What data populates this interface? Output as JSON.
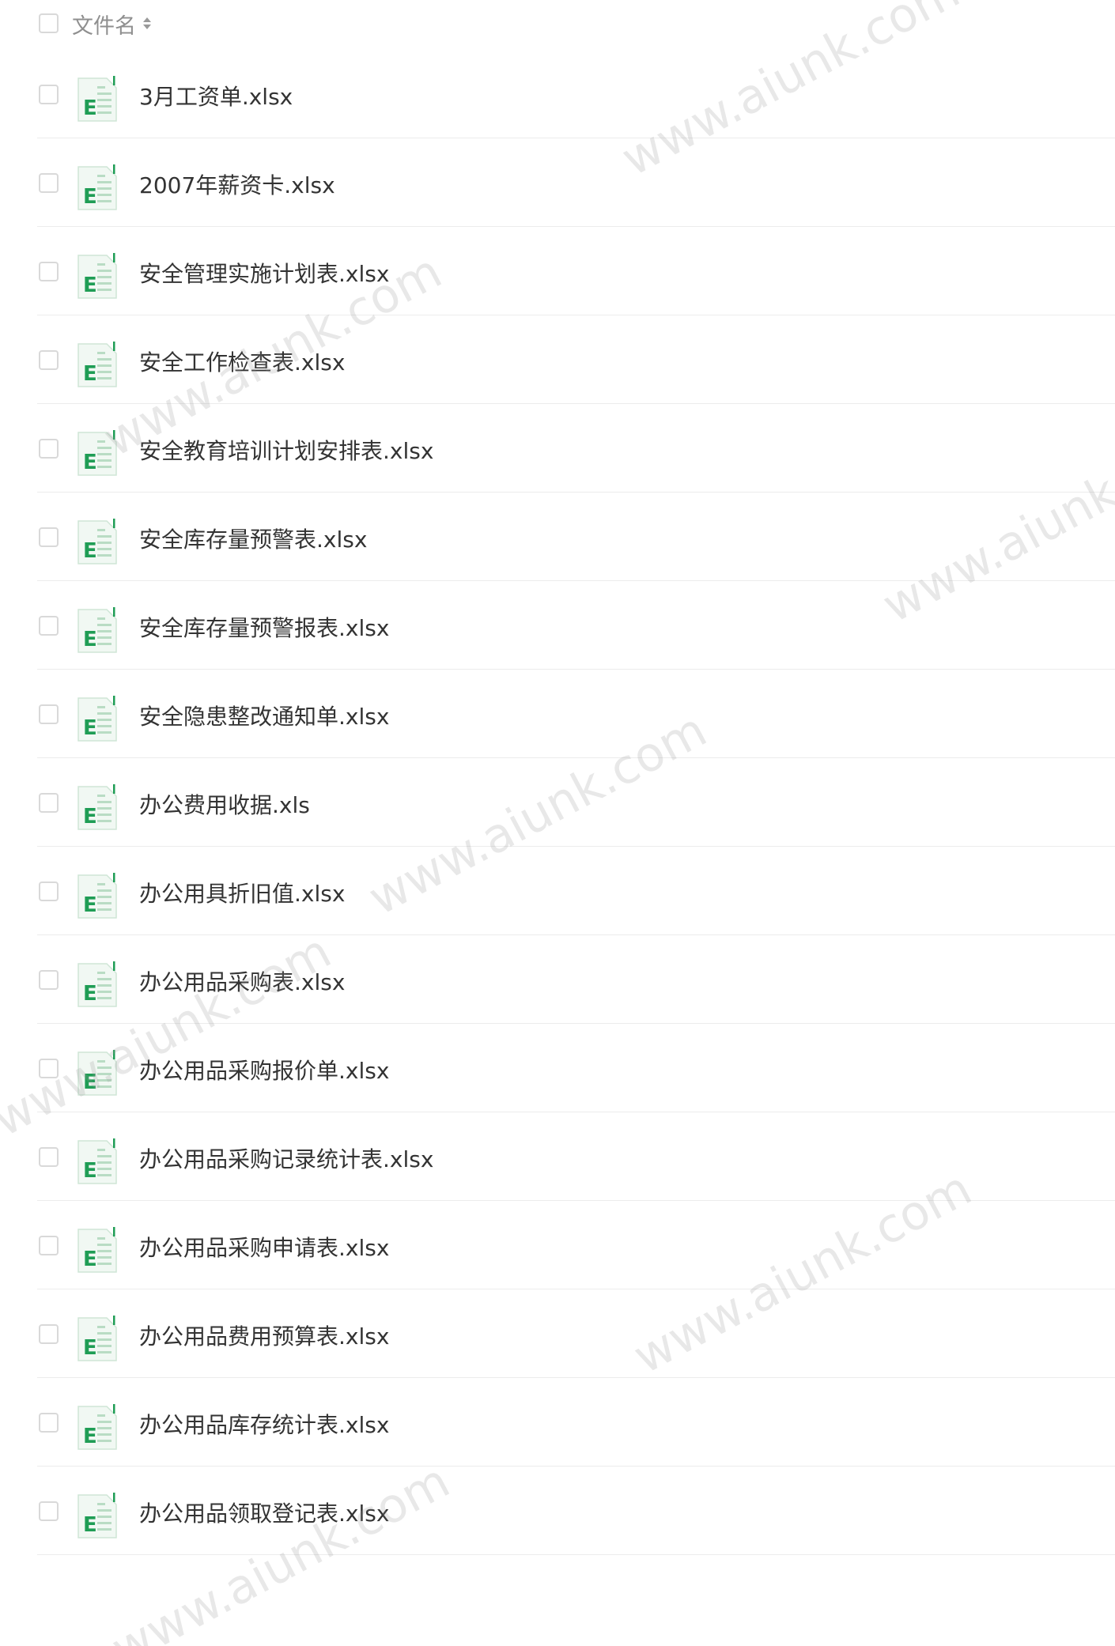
{
  "header": {
    "column_label": "文件名",
    "sort_icon": "sort-icon"
  },
  "files": [
    {
      "name": "3月工资单.xlsx"
    },
    {
      "name": "2007年薪资卡.xlsx"
    },
    {
      "name": "安全管理实施计划表.xlsx"
    },
    {
      "name": "安全工作检查表.xlsx"
    },
    {
      "name": "安全教育培训计划安排表.xlsx"
    },
    {
      "name": "安全库存量预警表.xlsx"
    },
    {
      "name": "安全库存量预警报表.xlsx"
    },
    {
      "name": "安全隐患整改通知单.xlsx"
    },
    {
      "name": "办公费用收据.xls"
    },
    {
      "name": "办公用具折旧值.xlsx"
    },
    {
      "name": "办公用品采购表.xlsx"
    },
    {
      "name": "办公用品采购报价单.xlsx"
    },
    {
      "name": "办公用品采购记录统计表.xlsx"
    },
    {
      "name": "办公用品采购申请表.xlsx"
    },
    {
      "name": "办公用品费用预算表.xlsx"
    },
    {
      "name": "办公用品库存统计表.xlsx"
    },
    {
      "name": "办公用品领取登记表.xlsx"
    }
  ],
  "watermark_text": "www.aiunk.com",
  "colors": {
    "excel_green": "#1f9d55",
    "text": "#333333",
    "header_text": "#8f8f8f"
  }
}
